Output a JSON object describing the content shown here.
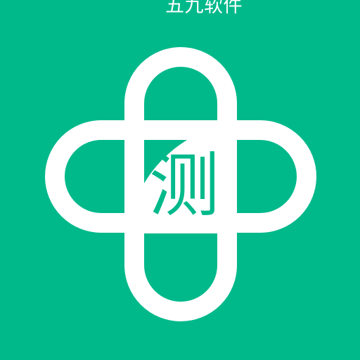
{
  "watermark": {
    "text": "五九软件"
  },
  "logo": {
    "name": "plus-cross-logo",
    "glyph": "测"
  },
  "colors": {
    "background": "#00B98B",
    "outline": "#FFFFFF",
    "glyph": "#00B98B"
  }
}
